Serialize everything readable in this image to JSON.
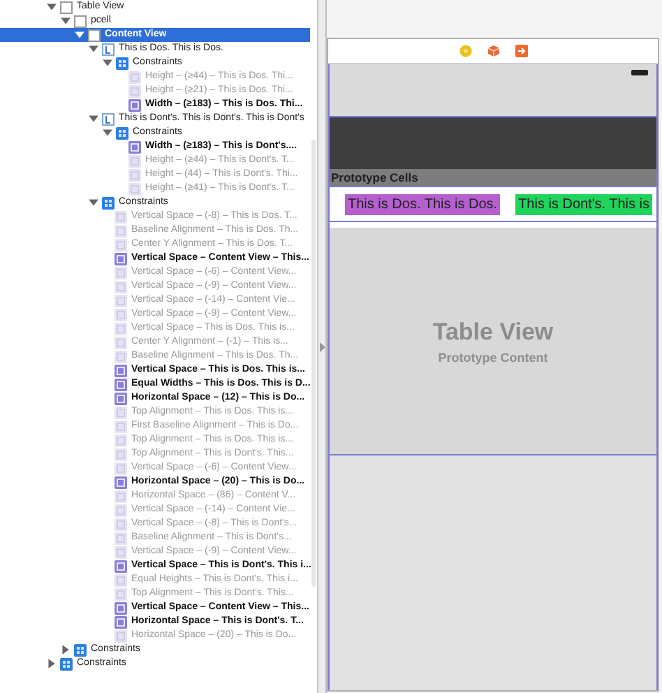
{
  "outline": {
    "items": [
      {
        "kind": "view",
        "label": "Table View",
        "expanded": true,
        "selected": false,
        "children": [
          {
            "kind": "view",
            "label": "pcell",
            "expanded": true,
            "selected": false,
            "children": [
              {
                "kind": "view",
                "label": "Content View",
                "expanded": true,
                "selected": true,
                "children": [
                  {
                    "kind": "label",
                    "label": "This is Dos. This is Dos.",
                    "expanded": true,
                    "selected": false,
                    "children": [
                      {
                        "kind": "constraints",
                        "label": "Constraints",
                        "expanded": true,
                        "selected": false,
                        "children": [
                          {
                            "kind": "constraint",
                            "label": "Height – (≥44) – This is Dos. Thi...",
                            "enabled": false,
                            "selected": false
                          },
                          {
                            "kind": "constraint",
                            "label": "Height – (≥21) – This is Dos. Thi...",
                            "enabled": false,
                            "selected": false
                          },
                          {
                            "kind": "constraint",
                            "label": "Width – (≥183) – This is Dos. Thi...",
                            "enabled": true,
                            "selected": false
                          }
                        ]
                      }
                    ]
                  },
                  {
                    "kind": "label",
                    "label": "This is Dont's. This is Dont's. This is Dont's",
                    "expanded": true,
                    "selected": false,
                    "children": [
                      {
                        "kind": "constraints",
                        "label": "Constraints",
                        "expanded": true,
                        "selected": false,
                        "children": [
                          {
                            "kind": "constraint",
                            "label": "Width – (≥183) – This is Dont's....",
                            "enabled": true,
                            "selected": false
                          },
                          {
                            "kind": "constraint",
                            "label": "Height – (≥44) – This is Dont's. T...",
                            "enabled": false,
                            "selected": false
                          },
                          {
                            "kind": "constraint",
                            "label": "Height – (44) – This is Dont's. Thi...",
                            "enabled": false,
                            "selected": false
                          },
                          {
                            "kind": "constraint",
                            "label": "Height – (≥41) – This is Dont's. T...",
                            "enabled": false,
                            "selected": false
                          }
                        ]
                      }
                    ]
                  },
                  {
                    "kind": "constraints",
                    "label": "Constraints",
                    "expanded": true,
                    "selected": false,
                    "children": [
                      {
                        "kind": "constraint",
                        "label": "Vertical Space – (-8) – This is Dos. T...",
                        "enabled": false,
                        "selected": false
                      },
                      {
                        "kind": "constraint",
                        "label": "Baseline Alignment – This is Dos. Th...",
                        "enabled": false,
                        "selected": false
                      },
                      {
                        "kind": "constraint",
                        "label": "Center Y Alignment – This is Dos. T...",
                        "enabled": false,
                        "selected": false
                      },
                      {
                        "kind": "constraint",
                        "label": "Vertical Space – Content View – This...",
                        "enabled": true,
                        "selected": false
                      },
                      {
                        "kind": "constraint",
                        "label": "Vertical Space – (-6) – Content View...",
                        "enabled": false,
                        "selected": false
                      },
                      {
                        "kind": "constraint",
                        "label": "Vertical Space – (-9) – Content View...",
                        "enabled": false,
                        "selected": false
                      },
                      {
                        "kind": "constraint",
                        "label": "Vertical Space – (-14) – Content Vie...",
                        "enabled": false,
                        "selected": false
                      },
                      {
                        "kind": "constraint",
                        "label": "Vertical Space – (-9) – Content View...",
                        "enabled": false,
                        "selected": false
                      },
                      {
                        "kind": "constraint",
                        "label": "Vertical Space – This is Dos. This is...",
                        "enabled": false,
                        "selected": false
                      },
                      {
                        "kind": "constraint",
                        "label": "Center Y Alignment – (-1) – This is...",
                        "enabled": false,
                        "selected": false
                      },
                      {
                        "kind": "constraint",
                        "label": "Baseline Alignment – This is Dos. Th...",
                        "enabled": false,
                        "selected": false
                      },
                      {
                        "kind": "constraint",
                        "label": "Vertical Space – This is Dos. This is...",
                        "enabled": true,
                        "selected": false
                      },
                      {
                        "kind": "constraint",
                        "label": "Equal Widths – This is Dos. This is D...",
                        "enabled": true,
                        "selected": false
                      },
                      {
                        "kind": "constraint",
                        "label": "Horizontal Space – (12) – This is Do...",
                        "enabled": true,
                        "selected": false
                      },
                      {
                        "kind": "constraint",
                        "label": "Top Alignment – This is Dos. This is...",
                        "enabled": false,
                        "selected": false
                      },
                      {
                        "kind": "constraint",
                        "label": "First Baseline Alignment – This is Do...",
                        "enabled": false,
                        "selected": false
                      },
                      {
                        "kind": "constraint",
                        "label": "Top Alignment – This is Dos. This is...",
                        "enabled": false,
                        "selected": false
                      },
                      {
                        "kind": "constraint",
                        "label": "Top Alignment – This is Dont's. This...",
                        "enabled": false,
                        "selected": false
                      },
                      {
                        "kind": "constraint",
                        "label": "Vertical Space – (-6) – Content View...",
                        "enabled": false,
                        "selected": false
                      },
                      {
                        "kind": "constraint",
                        "label": "Horizontal Space – (20) – This is Do...",
                        "enabled": true,
                        "selected": false
                      },
                      {
                        "kind": "constraint",
                        "label": "Horizontal Space – (86) – Content V...",
                        "enabled": false,
                        "selected": false
                      },
                      {
                        "kind": "constraint",
                        "label": "Vertical Space – (-14) – Content Vie...",
                        "enabled": false,
                        "selected": false
                      },
                      {
                        "kind": "constraint",
                        "label": "Vertical Space – (-8) – This is Dont's...",
                        "enabled": false,
                        "selected": false
                      },
                      {
                        "kind": "constraint",
                        "label": "Baseline Alignment – This is Dont's...",
                        "enabled": false,
                        "selected": false
                      },
                      {
                        "kind": "constraint",
                        "label": "Vertical Space – (-9) – Content View...",
                        "enabled": false,
                        "selected": false
                      },
                      {
                        "kind": "constraint",
                        "label": "Vertical Space – This is Dont's. This i...",
                        "enabled": true,
                        "selected": false
                      },
                      {
                        "kind": "constraint",
                        "label": "Equal Heights – This is Dont's. This i...",
                        "enabled": false,
                        "selected": false
                      },
                      {
                        "kind": "constraint",
                        "label": "Top Alignment – This is Dont's. This...",
                        "enabled": false,
                        "selected": false
                      },
                      {
                        "kind": "constraint",
                        "label": "Vertical Space – Content View – This...",
                        "enabled": true,
                        "selected": false
                      },
                      {
                        "kind": "constraint",
                        "label": "Horizontal Space – This is Dont's. T...",
                        "enabled": true,
                        "selected": false
                      },
                      {
                        "kind": "constraint",
                        "label": "Horizontal Space – (20) – This is Do...",
                        "enabled": false,
                        "selected": false
                      }
                    ]
                  }
                ]
              }
            ]
          },
          {
            "kind": "constraints",
            "label": "Constraints",
            "expanded": false,
            "selected": false
          }
        ]
      },
      {
        "kind": "constraints",
        "label": "Constraints",
        "expanded": false,
        "selected": false
      }
    ]
  },
  "canvas": {
    "section_header": "Prototype Cells",
    "cell_labels": [
      {
        "text": "This is Dos. This is Dos.",
        "color": "#b65fcf"
      },
      {
        "text": "This is Dont's. This is",
        "color": "#1fd35b"
      }
    ],
    "table_title": "Table View",
    "table_subtitle": "Prototype Content"
  }
}
